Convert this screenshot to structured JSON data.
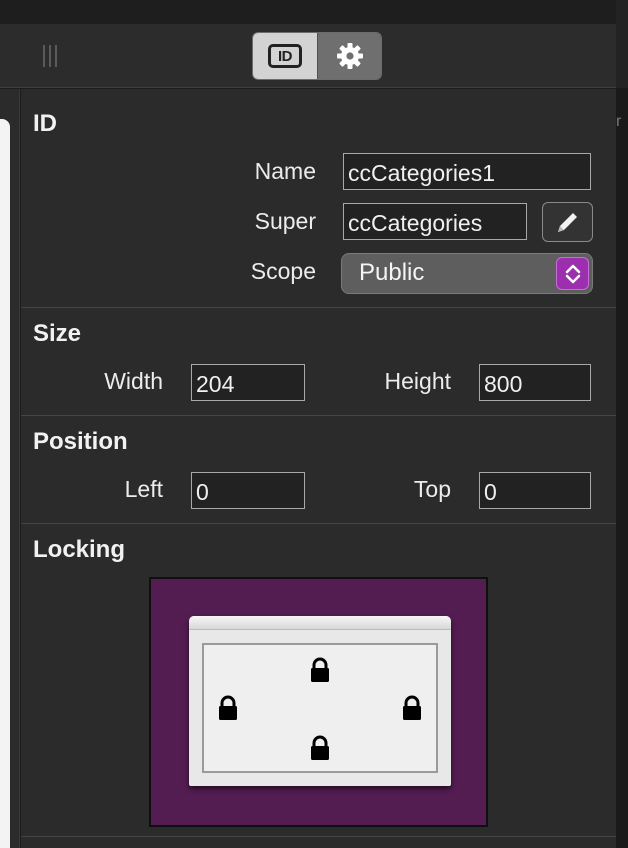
{
  "toolbar": {
    "id_tab_label": "ID",
    "id_tab_icon": "id-card-icon",
    "settings_tab_icon": "gear-icon",
    "active_tab": "ID"
  },
  "right_edge_char": "r",
  "id_section": {
    "title": "ID",
    "name_label": "Name",
    "name_value": "ccCategories1",
    "super_label": "Super",
    "super_value": "ccCategories",
    "scope_label": "Scope",
    "scope_value": "Public"
  },
  "size_section": {
    "title": "Size",
    "width_label": "Width",
    "width_value": "204",
    "height_label": "Height",
    "height_value": "800"
  },
  "position_section": {
    "title": "Position",
    "left_label": "Left",
    "left_value": "0",
    "top_label": "Top",
    "top_value": "0"
  },
  "locking_section": {
    "title": "Locking",
    "locks": [
      "top",
      "left",
      "right",
      "bottom"
    ],
    "colors": {
      "background": "#541d52",
      "select_accent": "#9b2fae"
    }
  }
}
